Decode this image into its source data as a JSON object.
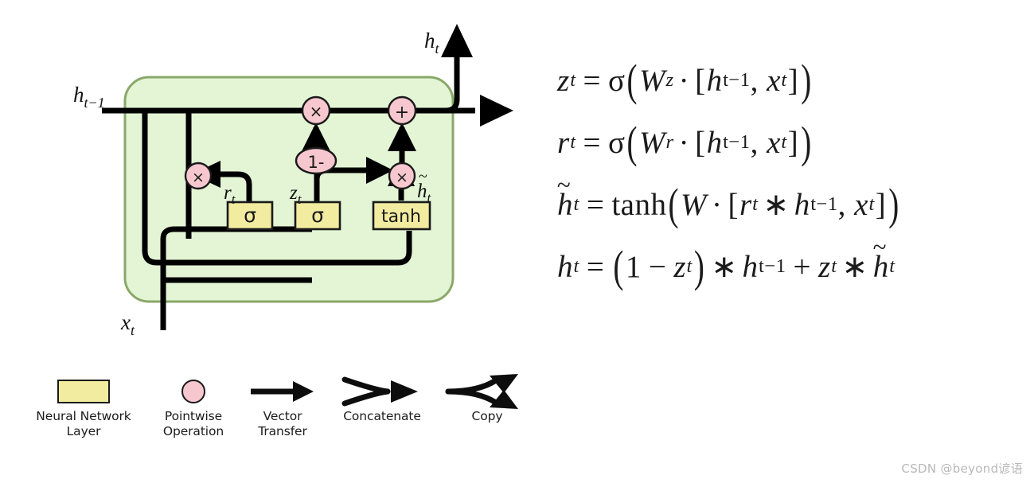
{
  "figure": {
    "type": "gru-cell-diagram",
    "title": "Gated Recurrent Unit (GRU) cell",
    "colors": {
      "cell_background": "#e3f5d5",
      "cell_border": "#8aa86a",
      "neural_layer_fill": "#f2eca0",
      "pointwise_fill": "#f7c7cf",
      "line": "#000000",
      "canvas": "#ffffff",
      "watermark_text": "#b9b9b9"
    }
  },
  "diagram": {
    "input_left_label": "h",
    "input_left_sub": "t−1",
    "input_bottom_label": "x",
    "input_bottom_sub": "t",
    "output_top_label": "h",
    "output_top_sub": "t",
    "gate_reset_label": "r",
    "gate_reset_sub": "t",
    "gate_update_label": "z",
    "gate_update_sub": "t",
    "candidate_label": "h",
    "candidate_sub": "t",
    "candidate_tilde": "~",
    "layers": [
      {
        "name": "reset-gate-sigmoid",
        "text": "σ"
      },
      {
        "name": "update-gate-sigmoid",
        "text": "σ"
      },
      {
        "name": "candidate-tanh",
        "text": "tanh"
      }
    ],
    "pointwise_ops": [
      {
        "name": "reset-multiply",
        "text": "×"
      },
      {
        "name": "forget-multiply",
        "text": "×"
      },
      {
        "name": "candidate-multiply",
        "text": "×"
      },
      {
        "name": "one-minus",
        "text": "1-"
      },
      {
        "name": "sum-add",
        "text": "+"
      }
    ]
  },
  "equations": [
    {
      "name": "update-gate-equation",
      "lhs": "z",
      "lhs_sub": "t",
      "text": "z_t = σ (W_z · [h_{t−1}, x_t])"
    },
    {
      "name": "reset-gate-equation",
      "lhs": "r",
      "lhs_sub": "t",
      "text": "r_t = σ (W_r · [h_{t−1}, x_t])"
    },
    {
      "name": "candidate-equation",
      "lhs": "h̃",
      "lhs_sub": "t",
      "text": "h̃_t = tanh (W · [r_t * h_{t−1}, x_t])"
    },
    {
      "name": "hidden-state-equation",
      "lhs": "h",
      "lhs_sub": "t",
      "text": "h_t = (1 − z_t) * h_{t−1} + z_t * h̃_t"
    }
  ],
  "eq_tokens": {
    "sigma": "σ",
    "tanh": "tanh",
    "W": "W",
    "z": "z",
    "r": "r",
    "h": "h",
    "x": "x",
    "t": "t",
    "tminus1": "t−1",
    "equals": "=",
    "dot": "·",
    "star": "∗",
    "plus": "+",
    "minus": "−",
    "comma": ",",
    "one": "1",
    "lparen": "(",
    "rparen": ")",
    "lbracket": "[",
    "rbracket": "]",
    "tilde": "~"
  },
  "legend": {
    "items": [
      {
        "name": "neural-network-layer",
        "glyph": "rect",
        "label": "Neural Network\nLayer"
      },
      {
        "name": "pointwise-operation",
        "glyph": "circle",
        "label": "Pointwise\nOperation"
      },
      {
        "name": "vector-transfer",
        "glyph": "arrow",
        "label": "Vector\nTransfer"
      },
      {
        "name": "concatenate",
        "glyph": "concat",
        "label": "Concatenate"
      },
      {
        "name": "copy",
        "glyph": "copy",
        "label": "Copy"
      }
    ]
  },
  "watermark": {
    "text": "CSDN @beyond谚语"
  }
}
